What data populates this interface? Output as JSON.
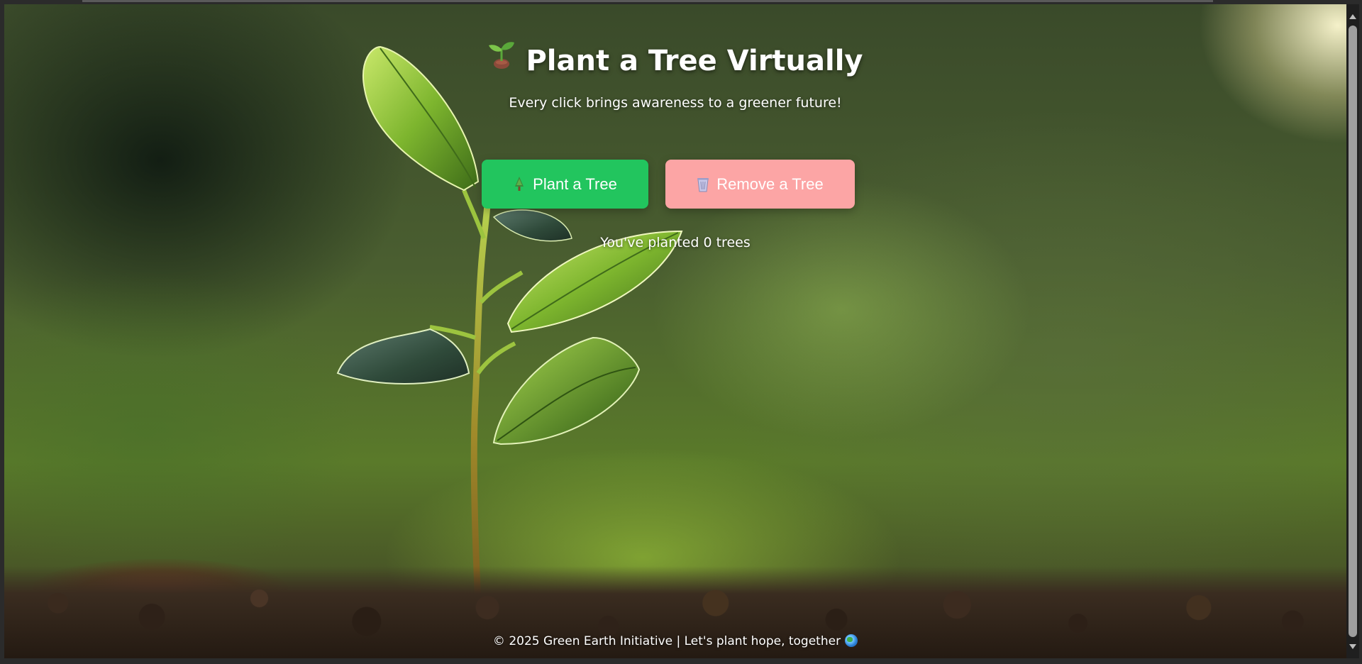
{
  "page": {
    "title": "Plant a Tree Virtually",
    "title_icon": "seedling-icon",
    "subtitle": "Every click brings awareness to a greener future!"
  },
  "actions": {
    "plant_label": "Plant a Tree",
    "plant_icon": "evergreen-tree-icon",
    "remove_label": "Remove a Tree",
    "remove_icon": "wastebasket-icon"
  },
  "counter": {
    "text": "You've planted 0 trees",
    "count": 0
  },
  "footer": {
    "text": "© 2025 Green Earth Initiative | Let's plant hope, together",
    "icon": "globe-icon"
  },
  "colors": {
    "plant_button": "#22c55e",
    "remove_button": "#fca5a5",
    "text": "#ffffff"
  }
}
